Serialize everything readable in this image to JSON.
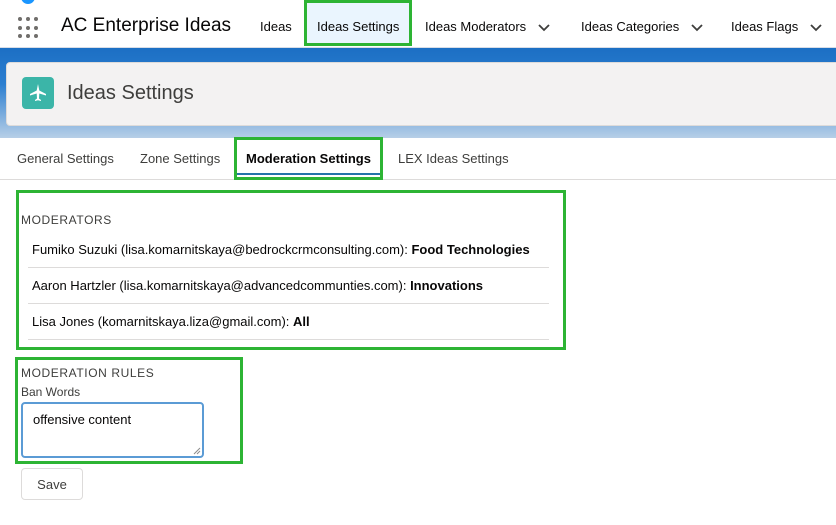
{
  "app": {
    "name": "AC Enterprise Ideas"
  },
  "nav": {
    "items": [
      {
        "label": "Ideas"
      },
      {
        "label": "Ideas Settings"
      },
      {
        "label": "Ideas Moderators"
      },
      {
        "label": "Ideas Categories"
      },
      {
        "label": "Ideas Flags"
      }
    ]
  },
  "header": {
    "title": "Ideas Settings",
    "icon": "airplane-icon"
  },
  "tabs": [
    {
      "label": "General Settings"
    },
    {
      "label": "Zone Settings"
    },
    {
      "label": "Moderation Settings"
    },
    {
      "label": "LEX Ideas Settings"
    }
  ],
  "moderators": {
    "heading": "MODERATORS",
    "rows": [
      {
        "person": "Fumiko Suzuki (lisa.komarnitskaya@bedrockcrmconsulting.com): ",
        "zone": "Food Technologies"
      },
      {
        "person": "Aaron Hartzler (lisa.komarnitskaya@advancedcommunties.com): ",
        "zone": "Innovations"
      },
      {
        "person": "Lisa Jones (komarnitskaya.liza@gmail.com): ",
        "zone": "All"
      }
    ]
  },
  "rules": {
    "heading": "MODERATION RULES",
    "ban_label": "Ban Words",
    "ban_value": "offensive content"
  },
  "actions": {
    "save_label": "Save"
  },
  "colors": {
    "highlight": "#2db434",
    "brand_blue": "#1c6fc4",
    "icon_teal": "#3bb5a8"
  }
}
